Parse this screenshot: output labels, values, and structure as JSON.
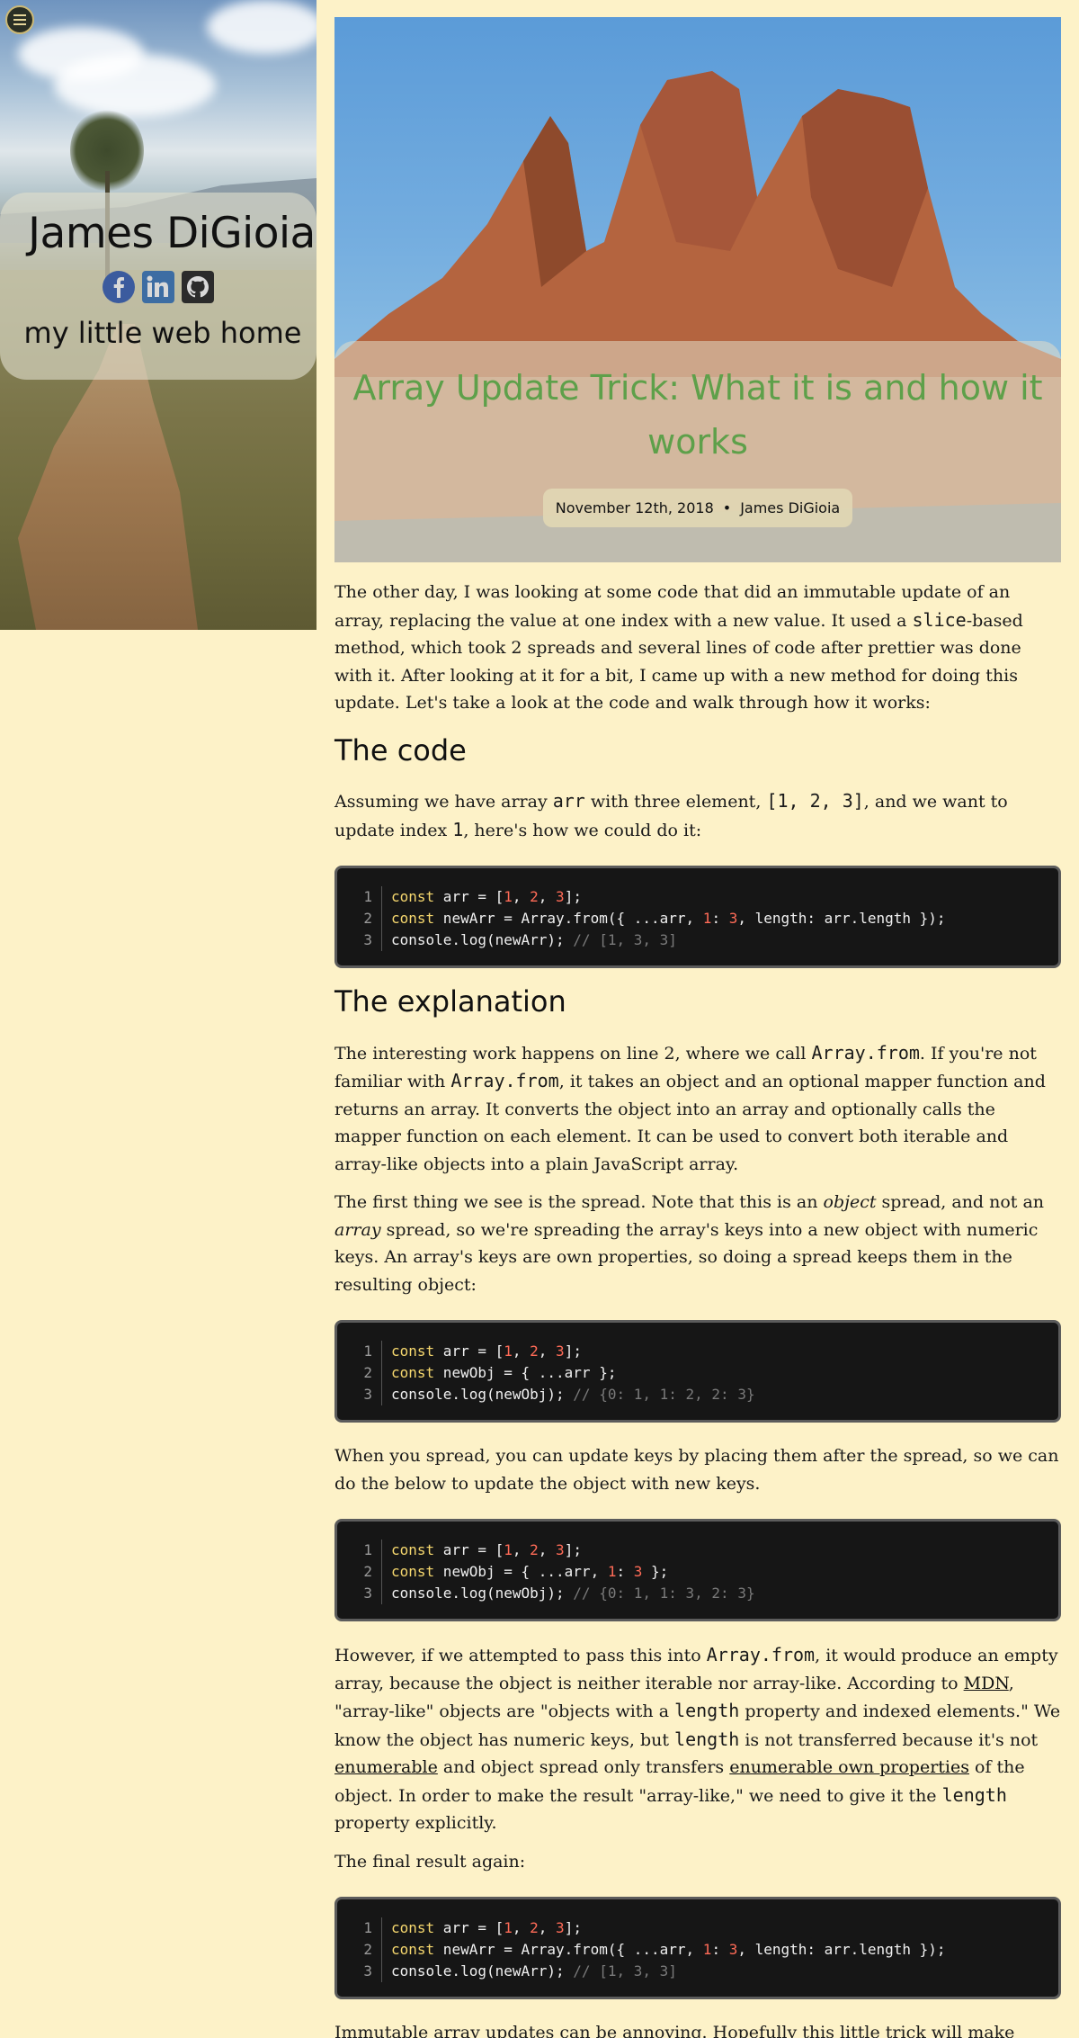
{
  "sidebar": {
    "site_title": "James DiGioia",
    "tagline": "my little web home",
    "social": [
      "facebook-icon",
      "linkedin-icon",
      "github-icon"
    ]
  },
  "post": {
    "title": "Array Update Trick: What it is and how it works",
    "date": "November 12th, 2018",
    "author": "James DiGioia"
  },
  "article": {
    "p1": [
      "The other day, I was looking at some code that did an immutable update of an array, replacing the value at one index with a new value. It used a ",
      "slice",
      "-based method, which took 2 spreads and several lines of code after prettier was done with it. After looking at it for a bit, I came up with a new method for doing this update. Let's take a look at the code and walk through how it works:"
    ],
    "h_code": "The code",
    "p2": [
      "Assuming we have array ",
      "arr",
      " with three element, ",
      "[1, 2, 3]",
      ", and we want to update index ",
      "1",
      ", here's how we could do it:"
    ],
    "code1": [
      [
        "const",
        " arr = [",
        "1",
        ", ",
        "2",
        ", ",
        "3",
        "];",
        ""
      ],
      [
        "const",
        " newArr = Array.from({ ...arr, ",
        "1",
        ": ",
        "3",
        ", length: arr.length });",
        "",
        "",
        ""
      ],
      [
        "",
        "console.log(newArr); ",
        "",
        "",
        "",
        "",
        "",
        "",
        "// [1, 3, 3]"
      ]
    ],
    "h_explanation": "The explanation",
    "p3": [
      "The interesting work happens on line 2, where we call ",
      "Array.from",
      ". If you're not familiar with ",
      "Array.from",
      ", it takes an object and an optional mapper function and returns an array. It converts the object into an array and optionally calls the mapper function on each element. It can be used to convert both iterable and array-like objects into a plain JavaScript array."
    ],
    "p4": [
      "The first thing we see is the spread. Note that this is an ",
      "object",
      " spread, and not an ",
      "array",
      " spread, so we're spreading the array's keys into a new object with numeric keys. An array's keys are own properties, so doing a spread keeps them in the resulting object:"
    ],
    "code2": [
      [
        "const",
        " arr = [",
        "1",
        ", ",
        "2",
        ", ",
        "3",
        "];",
        ""
      ],
      [
        "const",
        " newObj = { ...arr };",
        "",
        "",
        "",
        "",
        "",
        "",
        ""
      ],
      [
        "",
        "console.log(newObj); ",
        "",
        "",
        "",
        "",
        "",
        "",
        "// {0: 1, 1: 2, 2: 3}"
      ]
    ],
    "p5": "When you spread, you can update keys by placing them after the spread, so we can do the below to update the object with new keys.",
    "code3": [
      [
        "const",
        " arr = [",
        "1",
        ", ",
        "2",
        ", ",
        "3",
        "];",
        ""
      ],
      [
        "const",
        " newObj = { ...arr, ",
        "1",
        ": ",
        "3",
        " };",
        "",
        "",
        ""
      ],
      [
        "",
        "console.log(newObj); ",
        "",
        "",
        "",
        "",
        "",
        "",
        "// {0: 1, 1: 3, 2: 3}"
      ]
    ],
    "p6": [
      "However, if we attempted to pass this into ",
      "Array.from",
      ", it would produce an empty array, because the object is neither iterable nor array-like. According to ",
      "MDN",
      ", \"array-like\" objects are \"objects with a ",
      "length",
      " property and indexed elements.\" We know the object has numeric keys, but ",
      "length",
      " is not transferred because it's not ",
      "enumerable",
      " and object spread only transfers ",
      "enumerable own properties",
      " of the object. In order to make the result \"array-like,\" we need to give it the ",
      "length",
      " property explicitly."
    ],
    "p7": "The final result again:",
    "code4": [
      [
        "const",
        " arr = [",
        "1",
        ", ",
        "2",
        ", ",
        "3",
        "];",
        ""
      ],
      [
        "const",
        " newArr = Array.from({ ...arr, ",
        "1",
        ": ",
        "3",
        ", length: arr.length });",
        "",
        "",
        ""
      ],
      [
        "",
        "console.log(newArr); ",
        "",
        "",
        "",
        "",
        "",
        "",
        "// [1, 3, 3]"
      ]
    ],
    "p8": "Immutable array updates can be annoying. Hopefully this little trick will make them easier for you."
  },
  "colors": {
    "page_bg": "#fdf2c8",
    "title_green": "#5ea04a",
    "code_bg": "#161616",
    "code_keyword": "#f5d76e",
    "code_number": "#ff6b57"
  }
}
